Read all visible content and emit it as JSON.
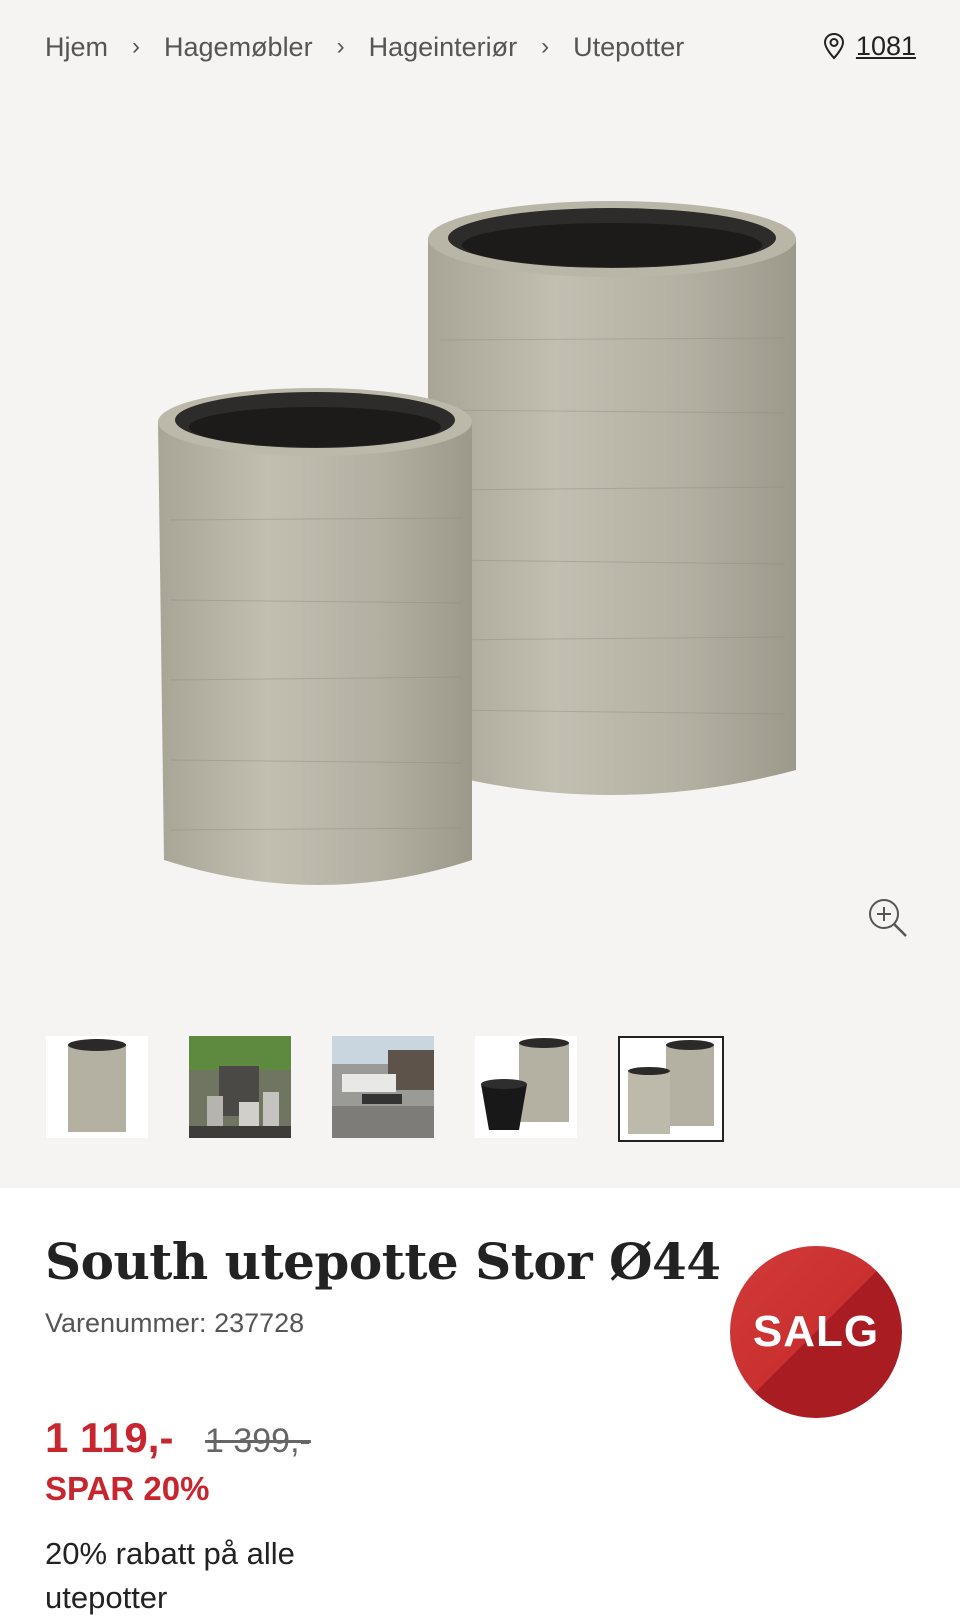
{
  "breadcrumb": {
    "items": [
      "Hjem",
      "Hagemøbler",
      "Hageinteriør",
      "Utepotter"
    ]
  },
  "store": {
    "code": "1081",
    "icon": "location-pin-icon"
  },
  "gallery": {
    "zoom_icon": "zoom-in-icon",
    "thumbnails": [
      {
        "alt": "single-pot"
      },
      {
        "alt": "garden-scene"
      },
      {
        "alt": "patio-scene"
      },
      {
        "alt": "pot-with-inner-pot"
      },
      {
        "alt": "two-pots",
        "selected": true
      }
    ]
  },
  "product": {
    "title": "South utepotte Stor Ø44",
    "sku_label": "Varenummer:",
    "sku_value": "237728",
    "badge": "SALG",
    "price": "1 119,-",
    "old_price": "1 399,-",
    "save": "SPAR 20%",
    "promo": "20% rabatt på alle utepotter"
  },
  "colors": {
    "sale_red": "#c8262e",
    "background": "#f6f4f3"
  }
}
